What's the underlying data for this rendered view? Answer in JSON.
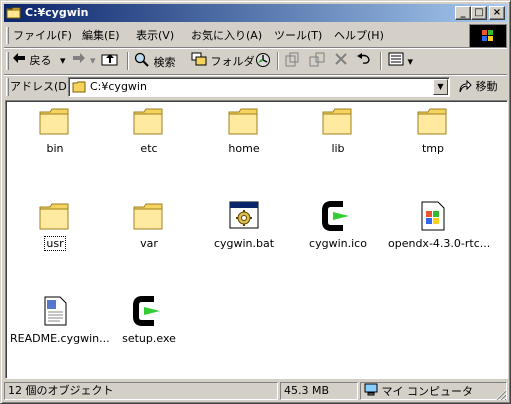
{
  "window": {
    "title": "C:¥cygwin"
  },
  "menu": [
    {
      "label": "ファイル(F)"
    },
    {
      "label": "編集(E)"
    },
    {
      "label": "表示(V)"
    },
    {
      "label": "お気に入り(A)"
    },
    {
      "label": "ツール(T)"
    },
    {
      "label": "ヘルプ(H)"
    }
  ],
  "toolbar": {
    "back_label": "戻る",
    "search_label": "検索",
    "folders_label": "フォルダ"
  },
  "address": {
    "label": "アドレス(D)",
    "value": "C:¥cygwin",
    "go_label": "移動"
  },
  "files": [
    {
      "name": "bin",
      "type": "folder"
    },
    {
      "name": "etc",
      "type": "folder"
    },
    {
      "name": "home",
      "type": "folder"
    },
    {
      "name": "lib",
      "type": "folder"
    },
    {
      "name": "tmp",
      "type": "folder"
    },
    {
      "name": "usr",
      "type": "folder"
    },
    {
      "name": "var",
      "type": "folder"
    },
    {
      "name": "cygwin.bat",
      "type": "batch"
    },
    {
      "name": "cygwin.ico",
      "type": "cygwin-icon"
    },
    {
      "name": "opendx-4.3.0-rtc...",
      "type": "installer"
    },
    {
      "name": "README.cygwin...",
      "type": "text"
    },
    {
      "name": "setup.exe",
      "type": "cygwin-icon"
    }
  ],
  "status": {
    "objects": "12 個のオブジェクト",
    "size": "45.3 MB",
    "location": "マイ コンピュータ"
  }
}
